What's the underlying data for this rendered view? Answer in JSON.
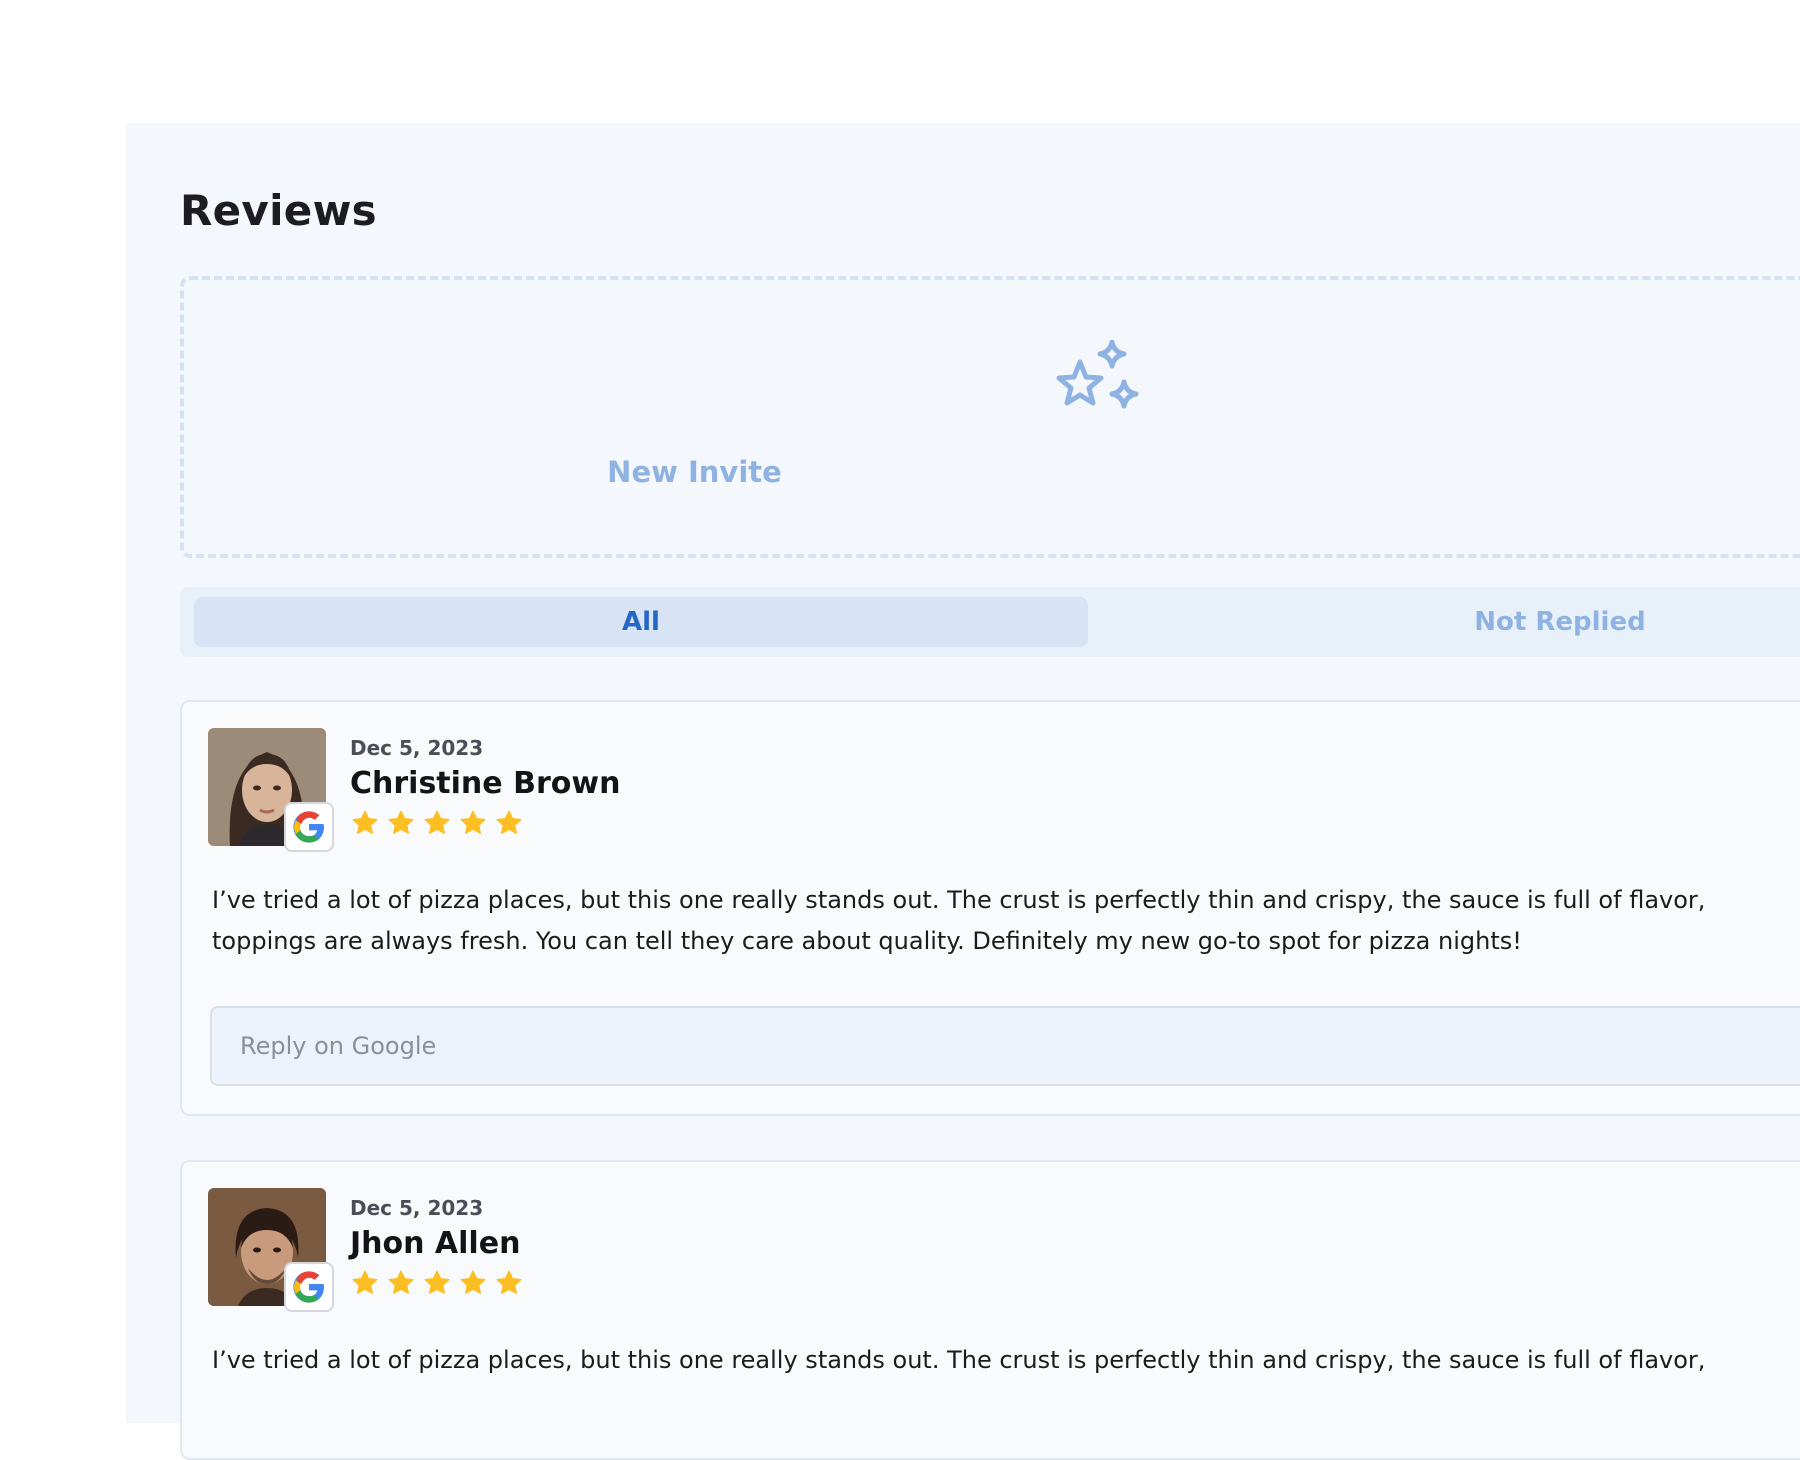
{
  "page": {
    "title": "Reviews"
  },
  "invite": {
    "label": "New Invite",
    "icon": "sparkle-stars-icon"
  },
  "tabs": [
    {
      "label": "All",
      "selected": true
    },
    {
      "label": "Not Replied",
      "selected": false
    }
  ],
  "reviews": [
    {
      "date": "Dec 5, 2023",
      "name": "Christine Brown",
      "rating": 5,
      "source_icon": "google-icon",
      "text_line1": "I’ve tried a lot of pizza places, but this one really stands out. The crust is perfectly thin and crispy, the sauce is full of flavor,",
      "text_line2": "toppings are always fresh. You can tell they care about quality. Definitely my new go-to spot for pizza nights!",
      "reply_placeholder": "Reply on Google"
    },
    {
      "date": "Dec 5, 2023",
      "name": "Jhon Allen",
      "rating": 5,
      "source_icon": "google-icon",
      "text_line1": "I’ve tried a lot of pizza places, but this one really stands out. The crust is perfectly thin and crispy, the sauce is full of flavor,"
    }
  ],
  "colors": {
    "accent": "#2567c4",
    "accent_light": "#8eb3e2",
    "star": "#fbbf24",
    "panel_bg": "#f4f7fb"
  }
}
